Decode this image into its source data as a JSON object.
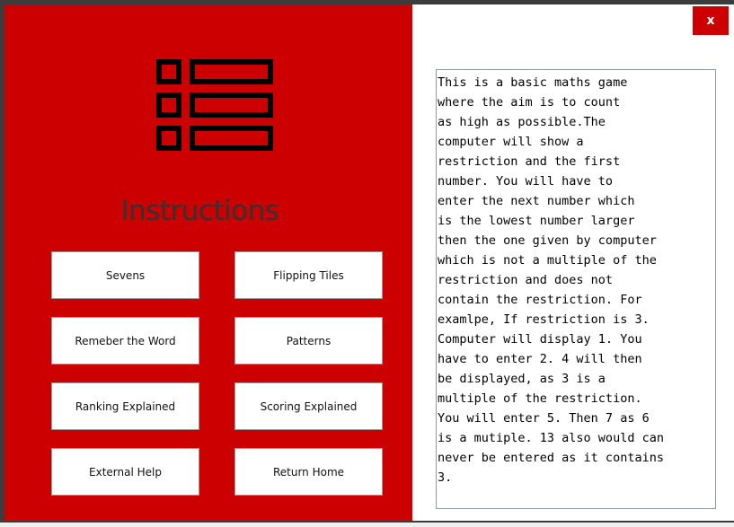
{
  "close_button": {
    "label": "x"
  },
  "left_panel": {
    "logo_icon": "list-menu-icon",
    "title": "Instructions",
    "buttons": [
      {
        "label": "Sevens"
      },
      {
        "label": "Flipping Tiles"
      },
      {
        "label": "Remeber the Word"
      },
      {
        "label": "Patterns"
      },
      {
        "label": "Ranking Explained"
      },
      {
        "label": "Scoring Explained"
      },
      {
        "label": "External Help"
      },
      {
        "label": "Return Home"
      }
    ]
  },
  "instructions_text": "This is a basic maths game\nwhere the aim is to count\nas high as possible.The\ncomputer will show a\nrestriction and the first\nnumber. You will have to\nenter the next number which\nis the lowest number larger\nthen the one given by computer\nwhich is not a multiple of the\nrestriction and does not\ncontain the restriction. For\nexamlpe, If restriction is 3.\nComputer will display 1. You\nhave to enter 2. 4 will then\nbe displayed, as 3 is a\nmultiple of the restriction.\nYou will enter 5. Then 7 as 6\nis a mutiple. 13 also would can\nnever be entered as it contains\n3.",
  "colors": {
    "panel_red": "#cc0000",
    "title_text": "#333333",
    "window_border": "#3c3c3c"
  }
}
